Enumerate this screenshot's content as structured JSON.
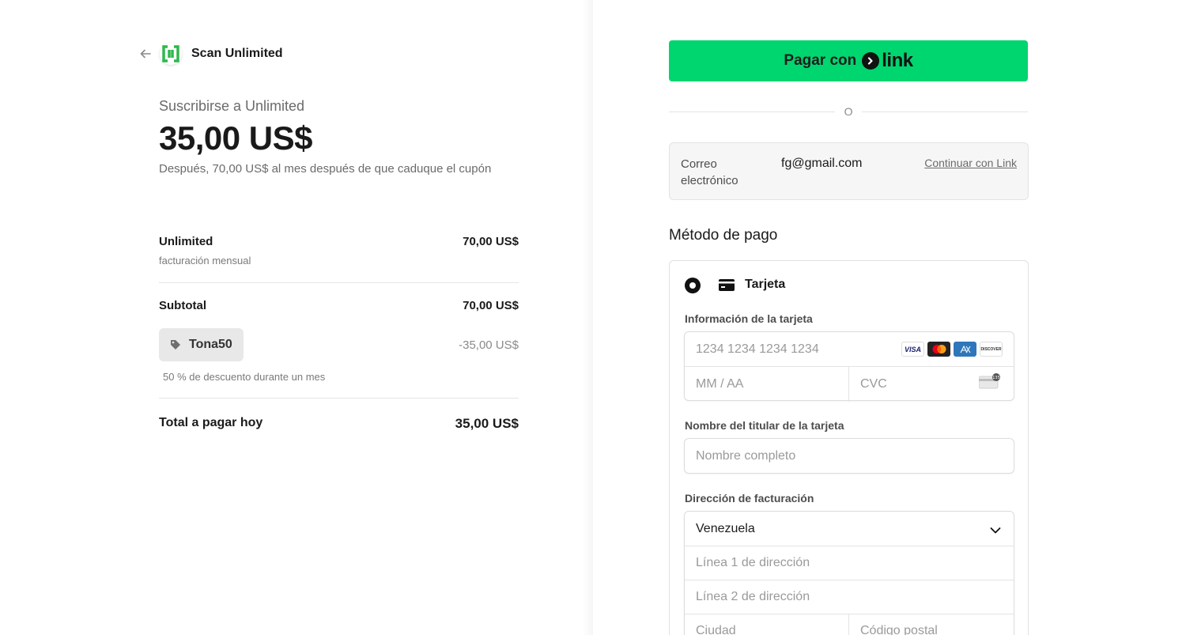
{
  "header": {
    "brand": "Scan Unlimited"
  },
  "summary": {
    "subscribe_label": "Suscribirse a Unlimited",
    "amount": "35,00 US$",
    "after_note": "Después, 70,00 US$ al mes después de que caduque el cupón"
  },
  "line_item": {
    "name": "Unlimited",
    "billing": "facturación mensual",
    "price": "70,00 US$"
  },
  "subtotal": {
    "label": "Subtotal",
    "value": "70,00 US$"
  },
  "coupon": {
    "code": "Tona50",
    "discount": "-35,00 US$",
    "description": "50 % de descuento durante un mes"
  },
  "total": {
    "label": "Total a pagar hoy",
    "value": "35,00 US$"
  },
  "link_button": {
    "prefix": "Pagar con",
    "brand": "link"
  },
  "separator": "O",
  "email": {
    "label": "Correo electrónico",
    "value": "fg@gmail.com",
    "link": "Continuar con Link"
  },
  "payment_method": {
    "title": "Método de pago",
    "option": "Tarjeta",
    "card_info_label": "Información de la tarjeta",
    "card_number_placeholder": "1234 1234 1234 1234",
    "expiry_placeholder": "MM / AA",
    "cvc_placeholder": "CVC",
    "card_brands": [
      "VISA",
      "mastercard",
      "amex",
      "DISCOVER"
    ],
    "cardholder_label": "Nombre del titular de la tarjeta",
    "cardholder_placeholder": "Nombre completo",
    "billing_label": "Dirección de facturación",
    "country": "Venezuela",
    "address1_placeholder": "Línea 1 de dirección",
    "address2_placeholder": "Línea 2 de dirección",
    "city_placeholder": "Ciudad",
    "postal_placeholder": "Código postal"
  },
  "colors": {
    "link_green": "#00d66f",
    "logo_green": "#2fb84c"
  }
}
